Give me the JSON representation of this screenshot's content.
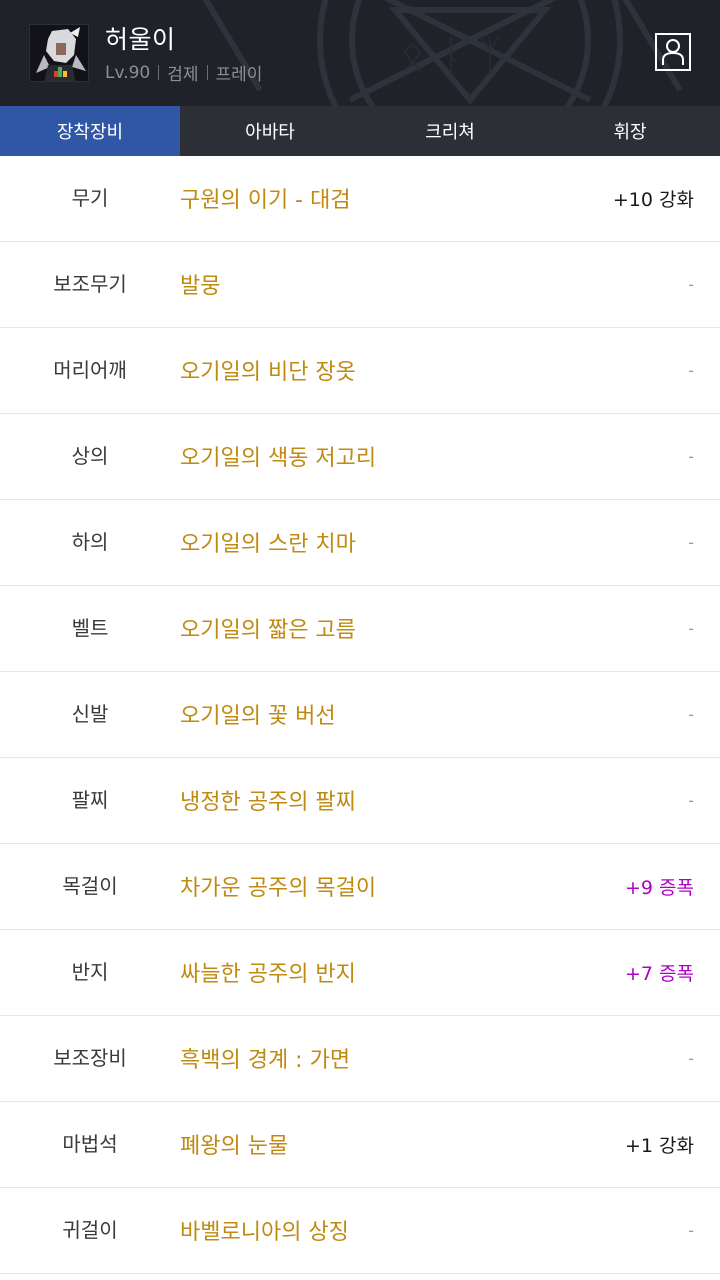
{
  "character": {
    "name": "허울이",
    "level": "Lv.90",
    "job": "검제",
    "server": "프레이"
  },
  "header": {
    "avatar_icon": "character-portrait",
    "profile_icon": "person-icon"
  },
  "tabs": [
    {
      "label": "장착장비",
      "active": true
    },
    {
      "label": "아바타",
      "active": false
    },
    {
      "label": "크리쳐",
      "active": false
    },
    {
      "label": "휘장",
      "active": false
    }
  ],
  "colors": {
    "accent": "#3057a6",
    "item_name": "#c08a10",
    "amplify": "#b000c8"
  },
  "equipment": [
    {
      "slot": "무기",
      "item": "구원의 이기 - 대검",
      "status": "+10 강화",
      "type": "reinforce"
    },
    {
      "slot": "보조무기",
      "item": "발뭉",
      "status": "-",
      "type": "none"
    },
    {
      "slot": "머리어깨",
      "item": "오기일의 비단 장옷",
      "status": "-",
      "type": "none"
    },
    {
      "slot": "상의",
      "item": "오기일의 색동 저고리",
      "status": "-",
      "type": "none"
    },
    {
      "slot": "하의",
      "item": "오기일의 스란 치마",
      "status": "-",
      "type": "none"
    },
    {
      "slot": "벨트",
      "item": "오기일의 짧은 고름",
      "status": "-",
      "type": "none"
    },
    {
      "slot": "신발",
      "item": "오기일의 꽃 버선",
      "status": "-",
      "type": "none"
    },
    {
      "slot": "팔찌",
      "item": "냉정한 공주의 팔찌",
      "status": "-",
      "type": "none"
    },
    {
      "slot": "목걸이",
      "item": "차가운 공주의 목걸이",
      "status": "+9 증폭",
      "type": "amplify"
    },
    {
      "slot": "반지",
      "item": "싸늘한 공주의 반지",
      "status": "+7 증폭",
      "type": "amplify"
    },
    {
      "slot": "보조장비",
      "item": "흑백의 경계 : 가면",
      "status": "-",
      "type": "none"
    },
    {
      "slot": "마법석",
      "item": "폐왕의 눈물",
      "status": "+1 강화",
      "type": "reinforce"
    },
    {
      "slot": "귀걸이",
      "item": "바벨로니아의 상징",
      "status": "-",
      "type": "none"
    }
  ]
}
